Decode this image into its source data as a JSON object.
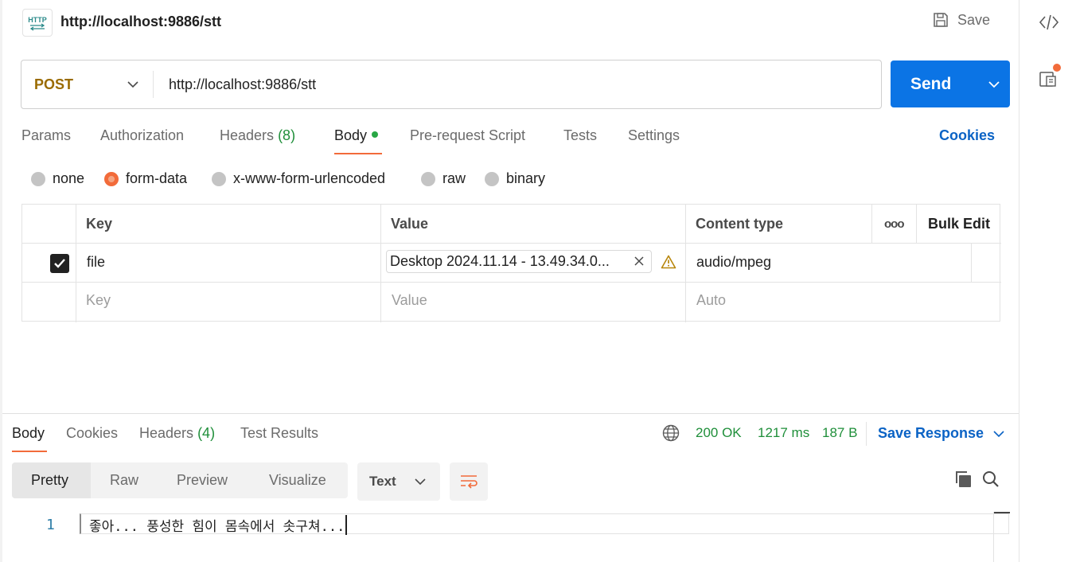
{
  "request": {
    "title": "http://localhost:9886/stt",
    "badge": "HTTP",
    "save_label": "Save",
    "method": "POST",
    "url": "http://localhost:9886/stt",
    "send_label": "Send"
  },
  "tabs": {
    "params": "Params",
    "authorization": "Authorization",
    "headers": "Headers",
    "headers_count": "(8)",
    "body": "Body",
    "prerequest": "Pre-request Script",
    "tests": "Tests",
    "settings": "Settings",
    "cookies": "Cookies"
  },
  "body_types": {
    "none": "none",
    "form_data": "form-data",
    "urlencoded": "x-www-form-urlencoded",
    "raw": "raw",
    "binary": "binary",
    "selected": "form-data"
  },
  "table": {
    "headers": {
      "key": "Key",
      "value": "Value",
      "content_type": "Content type",
      "more": "ooo",
      "bulk_edit": "Bulk Edit"
    },
    "rows": [
      {
        "checked": true,
        "key": "file",
        "value": "Desktop 2024.11.14 - 13.49.34.0...",
        "content_type": "audio/mpeg"
      }
    ],
    "placeholders": {
      "key": "Key",
      "value": "Value",
      "content_type": "Auto"
    }
  },
  "response": {
    "tabs": {
      "body": "Body",
      "cookies": "Cookies",
      "headers": "Headers",
      "headers_count": "(4)",
      "test_results": "Test Results"
    },
    "status": "200 OK",
    "time": "1217 ms",
    "size": "187 B",
    "save_response": "Save Response",
    "views": {
      "pretty": "Pretty",
      "raw": "Raw",
      "preview": "Preview",
      "visualize": "Visualize"
    },
    "format": "Text",
    "line_number": "1",
    "content": "좋아... 풍성한 힘이 몸속에서 솟구쳐..."
  },
  "colors": {
    "accent": "#f26b3a",
    "primary": "#0b74e5",
    "link": "#0b63c5",
    "success": "#1f8f3a",
    "method": "#9a6b00"
  }
}
